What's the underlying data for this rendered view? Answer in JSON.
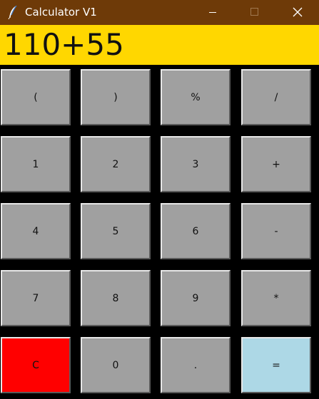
{
  "window": {
    "title": "Calculator V1",
    "titlebar_color": "#6e3a08",
    "icons": [
      "feather-icon",
      "minimize-icon",
      "maximize-icon",
      "close-icon"
    ]
  },
  "display": {
    "value": "110+55",
    "background": "#ffd700"
  },
  "colors": {
    "key": "#a0a0a0",
    "clear_key": "#ff0000",
    "equals_key": "#add8e6",
    "background": "#000000"
  },
  "keys": [
    [
      "(",
      ")",
      "%",
      "/"
    ],
    [
      "1",
      "2",
      "3",
      "+"
    ],
    [
      "4",
      "5",
      "6",
      "-"
    ],
    [
      "7",
      "8",
      "9",
      "*"
    ],
    [
      "C",
      "0",
      ".",
      "="
    ]
  ]
}
